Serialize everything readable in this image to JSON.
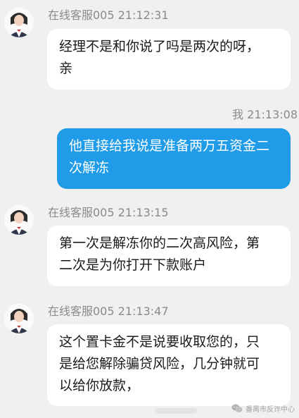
{
  "messages": [
    {
      "sender": "在线客服005",
      "time": "21:12:31",
      "lines": [
        "经理不是和你说了吗是两次的呀，",
        "亲"
      ]
    },
    {
      "sender": "我",
      "time": "21:13:08",
      "lines": [
        "他直接给我说是准备两万五资金二",
        "次解冻"
      ]
    },
    {
      "sender": "在线客服005",
      "time": "21:13:15",
      "lines": [
        "第一次是解冻你的二次高风险，第",
        "二次是为你打开下款账户"
      ]
    },
    {
      "sender": "在线客服005",
      "time": "21:13:47",
      "lines": [
        "这个置卡金不是说要收取您的，只",
        "是给您解除骗贷风险，几分钟就可",
        "以给你放款，"
      ]
    }
  ],
  "watermark": {
    "text": "番禺市反诈中心"
  },
  "colors": {
    "background": "#f0f0f0",
    "incoming_bubble": "#ffffff",
    "outgoing_bubble": "#1f9be8",
    "meta_text": "#8a8a8a"
  },
  "icons": {
    "agent_avatar": "agent-avatar-icon",
    "watermark": "wechat-icon"
  }
}
